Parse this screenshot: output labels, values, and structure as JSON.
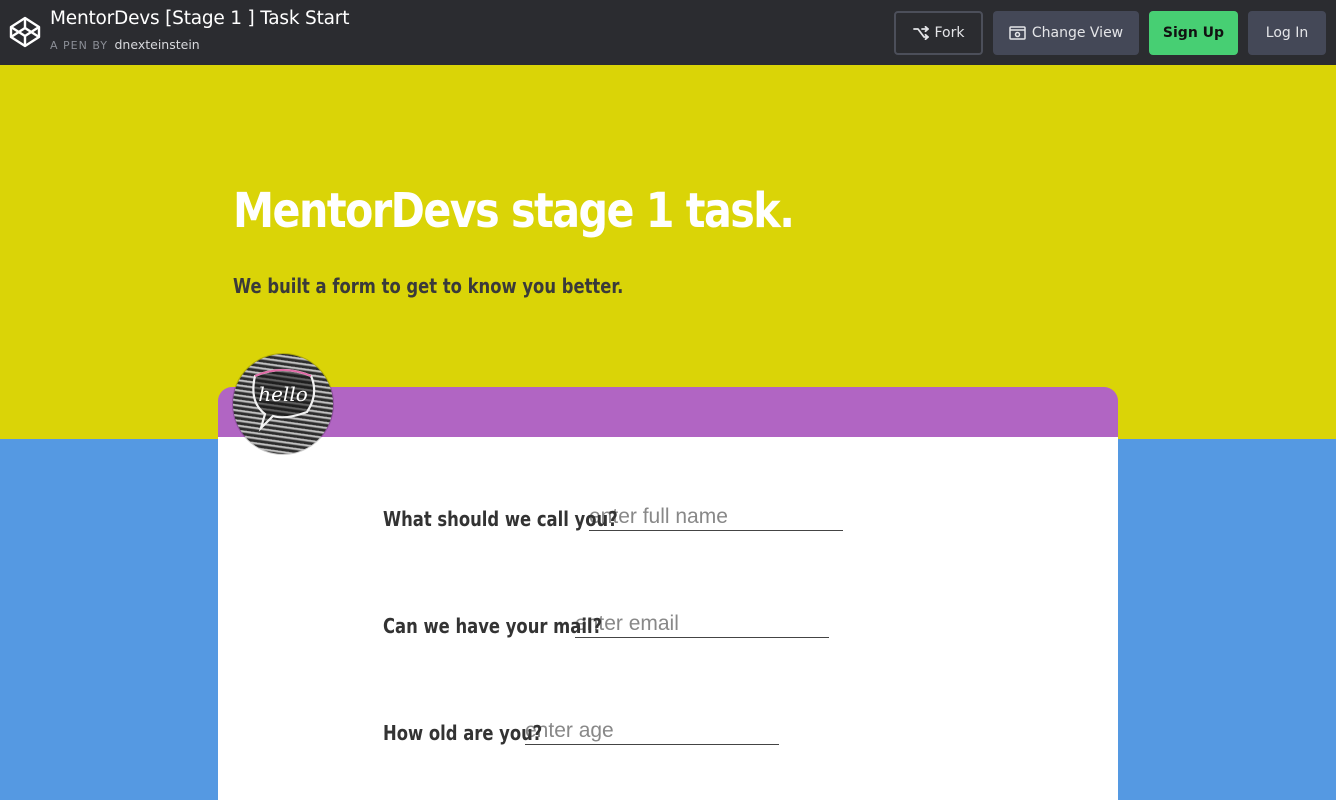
{
  "header": {
    "title": "MentorDevs [Stage 1 ] Task Start",
    "byline_prefix": "A PEN BY",
    "author": "dnexteinstein",
    "buttons": {
      "fork": "Fork",
      "change_view": "Change View",
      "sign_up": "Sign Up",
      "log_in": "Log In"
    },
    "icons": {
      "logo": "codepen-logo-icon",
      "fork": "fork-icon",
      "change_view": "view-icon"
    }
  },
  "hero": {
    "title": "MentorDevs stage 1 task.",
    "subtitle": "We built a form to get to know you better."
  },
  "card": {
    "avatar_text": "hello"
  },
  "form": {
    "name": {
      "label": "What should we call you?",
      "placeholder": "enter full name"
    },
    "email": {
      "label": "Can we have your mail?",
      "placeholder": "enter email"
    },
    "age": {
      "label": "How old are you?",
      "placeholder": "enter age"
    }
  },
  "colors": {
    "topbar": "#2b2c30",
    "hero": "#dad407",
    "card_header": "#b165c3",
    "background": "#5599e2",
    "sign_up": "#47cf73"
  }
}
